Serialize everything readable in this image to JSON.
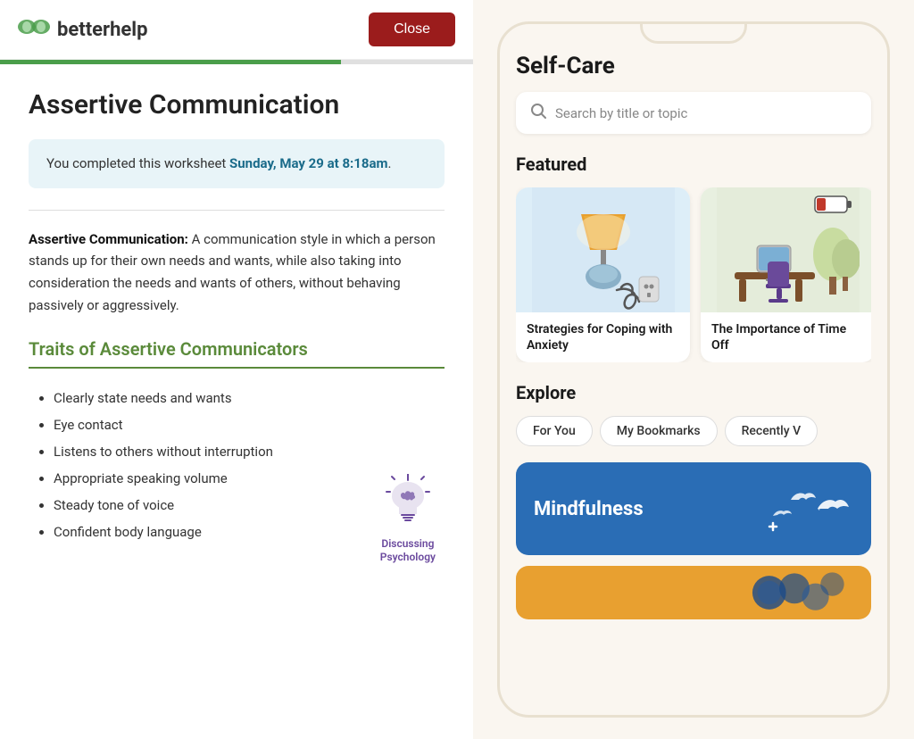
{
  "header": {
    "logo_text_light": "better",
    "logo_text_bold": "help",
    "close_label": "Close"
  },
  "progress": {
    "percent": 72
  },
  "worksheet": {
    "title": "Assertive Communication",
    "completion_text_start": "You completed this worksheet ",
    "completion_date": "Sunday, May 29 at 8:18am",
    "completion_text_end": ".",
    "description_bold": "Assertive Communication:",
    "description_rest": " A communication style in which a person stands up for their own needs and wants, while also taking into consideration the needs and wants of others, without behaving passively or aggressively.",
    "traits_heading": "Traits of Assertive Communicators",
    "traits": [
      "Clearly state needs and wants",
      "Eye contact",
      "Listens to others without interruption",
      "Appropriate speaking volume",
      "Steady tone of voice",
      "Confident body language"
    ],
    "badge_line1": "Discussing",
    "badge_line2": "Psychology"
  },
  "right": {
    "self_care_title": "Self-Care",
    "search_placeholder": "Search by title or topic",
    "featured_label": "Featured",
    "cards": [
      {
        "title": "Strategies for Coping with Anxiety",
        "type": "lamp"
      },
      {
        "title": "The Importance of Time Off",
        "type": "desk"
      }
    ],
    "explore_label": "Explore",
    "tabs": [
      {
        "label": "For You"
      },
      {
        "label": "My Bookmarks"
      },
      {
        "label": "Recently V"
      }
    ],
    "mindfulness_label": "Mindfulness",
    "orange_card_label": ""
  }
}
